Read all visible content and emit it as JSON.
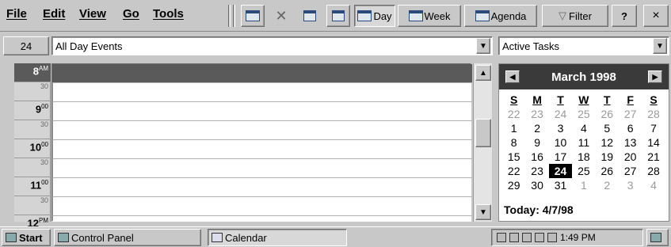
{
  "menu": {
    "file": "File",
    "edit": "Edit",
    "view": "View",
    "go": "Go",
    "tools": "Tools"
  },
  "toolbar": {
    "day": "Day",
    "week": "Week",
    "agenda": "Agenda",
    "filter": "Filter",
    "help": "?",
    "close": "×"
  },
  "day_header": {
    "day_number": "24",
    "all_day_events": "All Day Events",
    "active_tasks": "Active Tasks"
  },
  "time_slots": [
    {
      "label": "8",
      "suffix": "AM",
      "hour": true,
      "selected": true
    },
    {
      "label": "30",
      "hour": false
    },
    {
      "label": "9",
      "suffix": "00",
      "hour": true
    },
    {
      "label": "30",
      "hour": false
    },
    {
      "label": "10",
      "suffix": "00",
      "hour": true
    },
    {
      "label": "30",
      "hour": false
    },
    {
      "label": "11",
      "suffix": "00",
      "hour": true
    },
    {
      "label": "30",
      "hour": false
    },
    {
      "label": "12",
      "suffix": "PM",
      "hour": true
    }
  ],
  "calendar": {
    "month_label": "March 1998",
    "weekdays": [
      "S",
      "M",
      "T",
      "W",
      "T",
      "F",
      "S"
    ],
    "weeks": [
      [
        {
          "d": "22",
          "dim": true
        },
        {
          "d": "23",
          "dim": true
        },
        {
          "d": "24",
          "dim": true
        },
        {
          "d": "25",
          "dim": true
        },
        {
          "d": "26",
          "dim": true
        },
        {
          "d": "27",
          "dim": true
        },
        {
          "d": "28",
          "dim": true
        }
      ],
      [
        {
          "d": "1"
        },
        {
          "d": "2"
        },
        {
          "d": "3"
        },
        {
          "d": "4"
        },
        {
          "d": "5"
        },
        {
          "d": "6"
        },
        {
          "d": "7"
        }
      ],
      [
        {
          "d": "8"
        },
        {
          "d": "9"
        },
        {
          "d": "10"
        },
        {
          "d": "11"
        },
        {
          "d": "12"
        },
        {
          "d": "13"
        },
        {
          "d": "14"
        }
      ],
      [
        {
          "d": "15"
        },
        {
          "d": "16"
        },
        {
          "d": "17"
        },
        {
          "d": "18"
        },
        {
          "d": "19"
        },
        {
          "d": "20"
        },
        {
          "d": "21"
        }
      ],
      [
        {
          "d": "22"
        },
        {
          "d": "23"
        },
        {
          "d": "24",
          "sel": true
        },
        {
          "d": "25"
        },
        {
          "d": "26"
        },
        {
          "d": "27"
        },
        {
          "d": "28"
        }
      ],
      [
        {
          "d": "29"
        },
        {
          "d": "30"
        },
        {
          "d": "31"
        },
        {
          "d": "1",
          "dim": true
        },
        {
          "d": "2",
          "dim": true
        },
        {
          "d": "3",
          "dim": true
        },
        {
          "d": "4",
          "dim": true
        }
      ]
    ],
    "today_label": "Today: 4/7/98"
  },
  "taskbar": {
    "start": "Start",
    "control_panel": "Control Panel",
    "calendar": "Calendar",
    "clock": "1:49 PM"
  },
  "colors": {
    "selection": "#5a5a5a",
    "calendar_header": "#3a3a3a",
    "chrome": "#c8c8c8"
  }
}
